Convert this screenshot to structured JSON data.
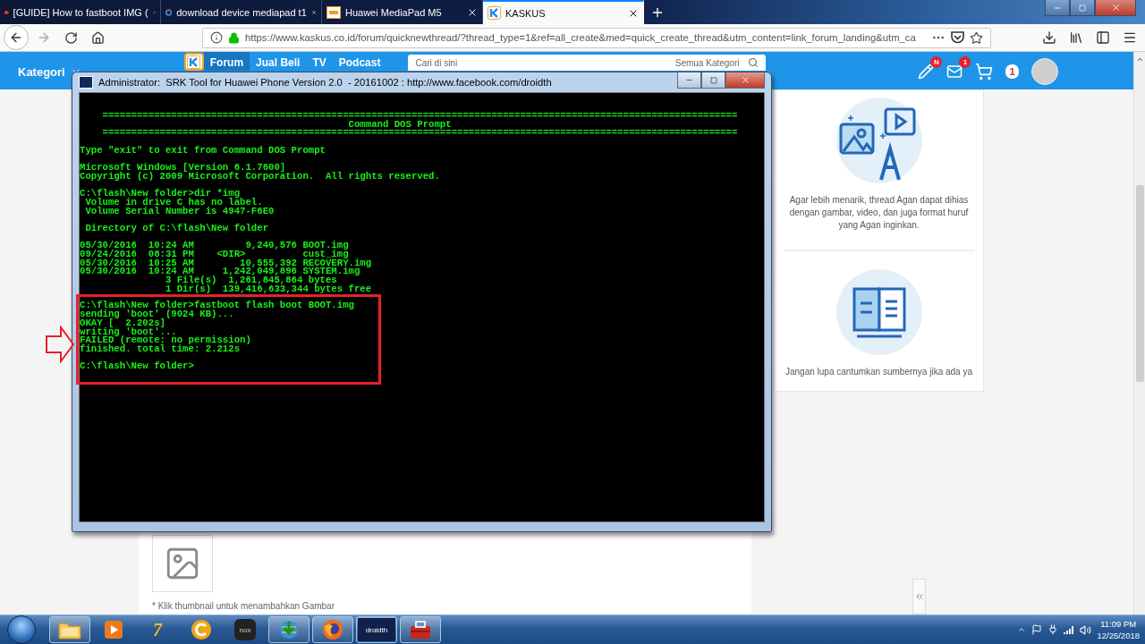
{
  "browser": {
    "tabs": [
      {
        "title": "[GUIDE] How to fastboot IMG (",
        "kind": "youtube",
        "selected": false
      },
      {
        "title": "download device mediapad t1",
        "kind": "google",
        "selected": false
      },
      {
        "title": "Huawei MediaPad M5",
        "kind": "xda",
        "selected": false
      },
      {
        "title": "KASKUS",
        "kind": "kaskus",
        "selected": true
      }
    ],
    "address": "https://www.kaskus.co.id/forum/quicknewthread/?thread_type=1&ref=all_create&med=quick_create_thread&utm_content=link_forum_landing&utm_ca"
  },
  "site_header": {
    "category_menu": "Kategori",
    "nav": [
      {
        "label": "Forum",
        "selected": true
      },
      {
        "label": "Jual Beli",
        "selected": false
      },
      {
        "label": "TV",
        "selected": false
      },
      {
        "label": "Podcast",
        "selected": false
      }
    ],
    "search": {
      "placeholder": "Cari di sini",
      "category": "Semua Kategori"
    },
    "notifications_badge": "N",
    "messages_badge": "1",
    "count_badge": "1"
  },
  "editor": {
    "caption": "* Klik thumbnail untuk menambahkan Gambar"
  },
  "tips": [
    {
      "kind": "media",
      "text": "Agar lebih menarik, thread Agan dapat dihias dengan gambar, video, dan juga format huruf yang Agan inginkan."
    },
    {
      "kind": "source",
      "text": "Jangan lupa cantumkan sumbernya jika ada ya"
    }
  ],
  "console": {
    "title": "Administrator:  SRK Tool for Huawei Phone Version 2.0  - 20161002 : http://www.facebook.com/droidth",
    "header": {
      "rule": "===============================================================================================================",
      "title": "Command DOS Prompt"
    },
    "sections": [
      {
        "highlighted": false,
        "paragraphs": [
          [
            "Type \"exit\" to exit from Command DOS Prompt"
          ],
          [
            "Microsoft Windows [Version 6.1.7600]",
            "Copyright (c) 2009 Microsoft Corporation.  All rights reserved."
          ],
          [
            "C:\\flash\\New folder>dir *img",
            " Volume in drive C has no label.",
            " Volume Serial Number is 4947-F6E0"
          ],
          [
            " Directory of C:\\flash\\New folder"
          ],
          [
            "05/30/2016  10:24 AM         9,240,576 BOOT.img",
            "09/24/2016  08:31 PM    <DIR>          cust_img",
            "05/30/2016  10:25 AM        10,555,392 RECOVERY.img",
            "05/30/2016  10:24 AM     1,242,049,896 SYSTEM.img",
            "               3 File(s)  1,261,845,864 bytes",
            "               1 Dir(s)  139,416,633,344 bytes free"
          ]
        ]
      },
      {
        "highlighted": true,
        "paragraphs": [
          [
            "C:\\flash\\New folder>fastboot flash boot BOOT.img",
            "sending 'boot' (9024 KB)...",
            "OKAY [  2.202s]",
            "writing 'boot'...",
            "FAILED (remote: no permission)",
            "finished. total time: 2.212s"
          ],
          [
            "C:\\flash\\New folder>"
          ]
        ]
      }
    ]
  },
  "taskbar": {
    "apps": [
      {
        "kind": "explorer",
        "running": true
      },
      {
        "kind": "media",
        "running": false
      },
      {
        "kind": "sevenzip",
        "label": "7",
        "running": false
      },
      {
        "kind": "cleaner",
        "running": false
      },
      {
        "kind": "nox",
        "label": "nox",
        "running": false
      },
      {
        "kind": "downloader",
        "running": true
      },
      {
        "kind": "firefox",
        "running": true
      },
      {
        "kind": "droidth",
        "label": "droidth",
        "running": true
      },
      {
        "kind": "toolbox",
        "running": true
      }
    ],
    "time": "11:09 PM",
    "date": "12/25/2018"
  }
}
